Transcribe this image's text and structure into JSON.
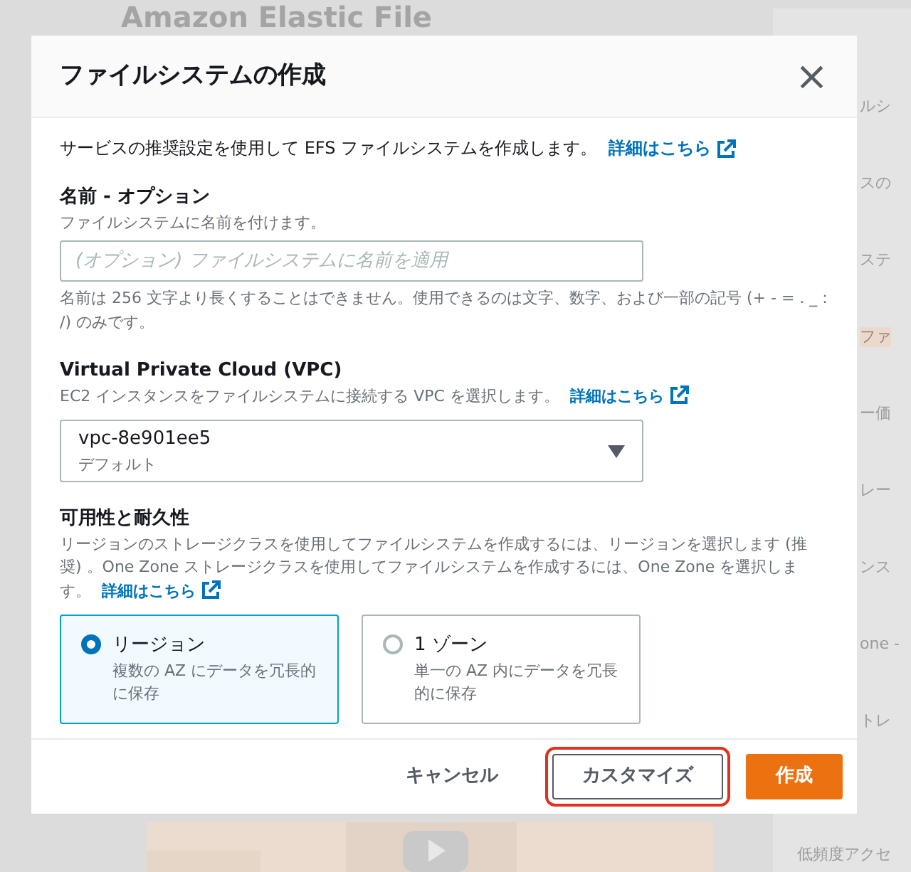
{
  "background": {
    "heading": "Amazon Elastic File",
    "side_texts": [
      "ルシ",
      "スの",
      "ステ",
      "ファ",
      "ー価",
      "レー",
      "ンス",
      "one -",
      "トレ",
      "低頻度アクセ"
    ]
  },
  "dialog": {
    "title": "ファイルシステムの作成",
    "close": "×",
    "intro": {
      "text": "サービスの推奨設定を使用して EFS ファイルシステムを作成します。",
      "link": "詳細はこちら"
    },
    "name_field": {
      "label": "名前 - オプション",
      "description": "ファイルシステムに名前を付けます。",
      "placeholder": "(オプション) ファイルシステムに名前を適用",
      "constraint": "名前は 256 文字より長くすることはできません。使用できるのは文字、数字、および一部の記号 (+ - = . _ : /) のみです。"
    },
    "vpc": {
      "label": "Virtual Private Cloud (VPC)",
      "description": "EC2 インスタンスをファイルシステムに接続する VPC を選択します。",
      "link": "詳細はこちら",
      "value": "vpc-8e901ee5",
      "sublabel": "デフォルト"
    },
    "availability": {
      "label": "可用性と耐久性",
      "description": "リージョンのストレージクラスを使用してファイルシステムを作成するには、リージョンを選択します (推奨) 。One Zone ストレージクラスを使用してファイルシステムを作成するには、One Zone を選択します。",
      "link": "詳細はこちら",
      "options": [
        {
          "title": "リージョン",
          "description": "複数の AZ にデータを冗長的に保存",
          "selected": true
        },
        {
          "title": "1 ゾーン",
          "description": "単一の AZ 内にデータを冗長的に保存",
          "selected": false
        }
      ]
    },
    "buttons": [
      {
        "label": "キャンセル",
        "kind": "link",
        "highlighted": false
      },
      {
        "label": "カスタマイズ",
        "kind": "secondary",
        "highlighted": true
      },
      {
        "label": "作成",
        "kind": "primary",
        "highlighted": false
      }
    ]
  }
}
